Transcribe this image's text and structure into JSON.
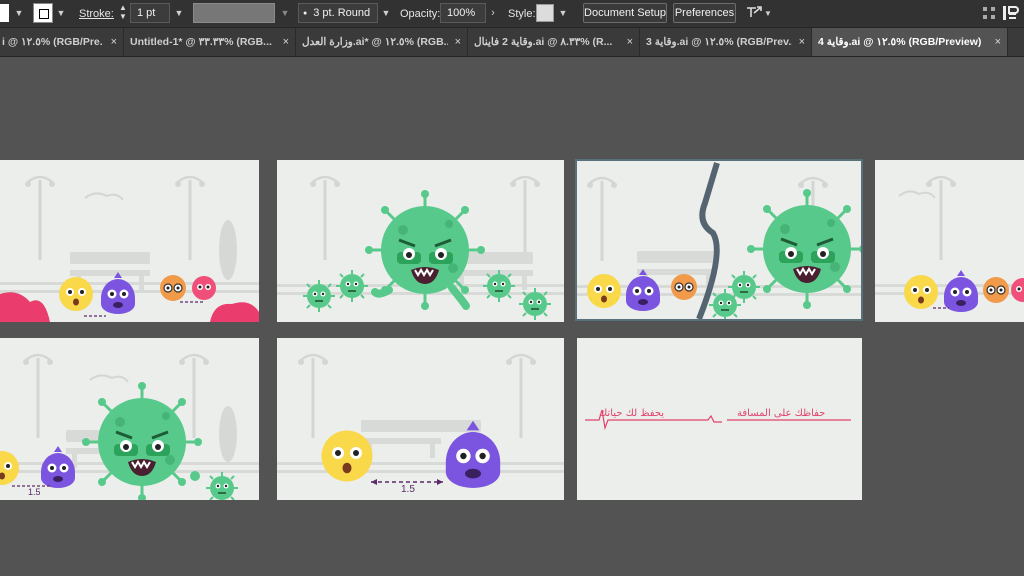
{
  "control_bar": {
    "stroke_label": "Stroke:",
    "stroke_weight": "1 pt",
    "brush_value": "3 pt. Round",
    "opacity_label": "Opacity:",
    "opacity_value": "100%",
    "style_label": "Style:",
    "document_setup_button": "Document Setup",
    "preferences_button": "Preferences"
  },
  "tabs": [
    {
      "label": "i @ ١٢.٥% (RGB/Pre...",
      "close": "×",
      "active": false
    },
    {
      "label": "Untitled-1* @ ٣٣.٣٣% (RGB...",
      "close": "×",
      "active": false
    },
    {
      "label": "وزارة العدل.ai* @ ١٢.٥% (RGB...",
      "close": "×",
      "active": false
    },
    {
      "label": "وقاية 2 فاينال.ai @ ٨.٣٣% (R...",
      "close": "×",
      "active": false
    },
    {
      "label": "وقاية 3.ai @ ١٢.٥% (RGB/Prev...",
      "close": "×",
      "active": false
    },
    {
      "label": "وقاية 4.ai @ ١٢.٥% (RGB/Preview)",
      "close": "×",
      "active": true
    }
  ],
  "artboards": {
    "distance_label": "1.5",
    "slogan_left": "يحفظ لك حياتك",
    "slogan_right": "حفاظك على المسافة"
  },
  "colors": {
    "virus_green": "#57c98a",
    "yellow_char": "#f9d84a",
    "purple_char": "#7b55e0",
    "orange_char": "#f19a4a",
    "pink_char": "#ef4f79",
    "pink_bush": "#ea3d6e",
    "slogan_pink": "#e2426b"
  }
}
